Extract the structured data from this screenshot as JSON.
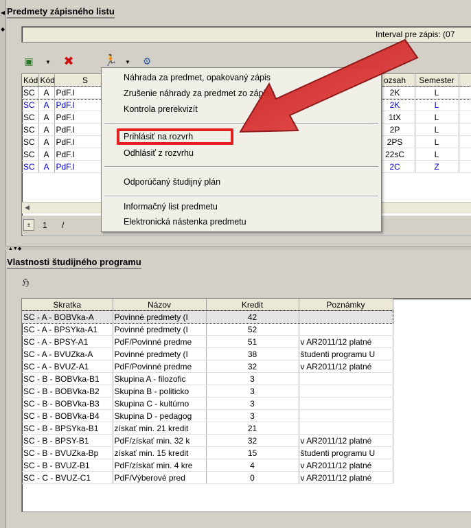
{
  "top": {
    "title": "Predmety zápisného listu",
    "interval_label": "Interval pre zápis: (07"
  },
  "toolbar": {
    "icons": [
      "add-document-icon",
      "delete-icon",
      "runner-icon",
      "tools-icon"
    ]
  },
  "table1": {
    "headers": [
      "Kód",
      "Kód",
      "S",
      "ozsah",
      "Semester"
    ],
    "rows": [
      [
        "SC",
        "A",
        "PdF.I",
        "2K",
        "L"
      ],
      [
        "SC",
        "A",
        "PdF.I",
        "2K",
        "L"
      ],
      [
        "SC",
        "A",
        "PdF.I",
        "1tX",
        "L"
      ],
      [
        "SC",
        "A",
        "PdF.I",
        "2P",
        "L"
      ],
      [
        "SC",
        "A",
        "PdF.I",
        "2PS",
        "L"
      ],
      [
        "SC",
        "A",
        "PdF.I",
        "22sC",
        "L"
      ],
      [
        "SC",
        "A",
        "PdF.I",
        "2C",
        "Z"
      ]
    ],
    "blue_rows": [
      1,
      6
    ],
    "pager": {
      "page": "1",
      "sep": "/"
    }
  },
  "context_menu": {
    "items": [
      "Náhrada za predmet, opakovaný zápis",
      "Zrušenie náhrady za predmet zo zápisu",
      "Kontrola prerekvizít",
      "Prihlásiť na rozvrh",
      "Odhlásiť z rozvrhu",
      "Odporúčaný študijný plán",
      "Informačný list predmetu",
      "Elektronická nástenka predmetu"
    ],
    "highlight_color": "#e02020"
  },
  "bottom": {
    "title": "Vlastnosti študijného programu",
    "headers": [
      "Skratka",
      "Názov",
      "Kredit",
      "Poznámky"
    ],
    "rows": [
      [
        "SC - A - BOBVka-A",
        "Povinné predmety (I",
        "42",
        ""
      ],
      [
        "SC - A - BPSYka-A1",
        "Povinné predmety (I",
        "52",
        ""
      ],
      [
        "SC - A - BPSY-A1",
        "PdF/Povinné predme",
        "51",
        "v AR2011/12 platné"
      ],
      [
        "SC - A - BVUZka-A",
        "Povinné predmety (I",
        "38",
        "študenti programu U"
      ],
      [
        "SC - A - BVUZ-A1",
        "PdF/Povinné predme",
        "32",
        "v AR2011/12 platné"
      ],
      [
        "SC - B - BOBVka-B1",
        "Skupina A - filozofic",
        "3",
        ""
      ],
      [
        "SC - B - BOBVka-B2",
        "Skupina B - politicko",
        "3",
        ""
      ],
      [
        "SC - B - BOBVka-B3",
        "Skupina C - kultúrno",
        "3",
        ""
      ],
      [
        "SC - B - BOBVka-B4",
        "Skupina D - pedagog",
        "3",
        ""
      ],
      [
        "SC - B - BPSYka-B1",
        "získať min. 21 kredit",
        "21",
        ""
      ],
      [
        "SC - B - BPSY-B1",
        "PdF/získať min. 32 k",
        "32",
        "v AR2011/12 platné"
      ],
      [
        "SC - B - BVUZka-Bp",
        "získať min. 15 kredit",
        "15",
        "študenti programu U"
      ],
      [
        "SC - B - BVUZ-B1",
        "PdF/získať min. 4 kre",
        "4",
        "v AR2011/12 platné"
      ],
      [
        "SC - C - BVUZ-C1",
        "PdF/Výberové pred",
        "0",
        "v AR2011/12 platné"
      ]
    ]
  }
}
